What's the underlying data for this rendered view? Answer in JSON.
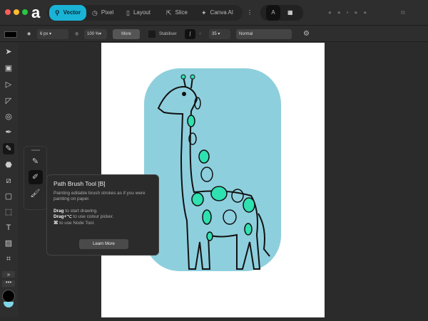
{
  "personas": [
    {
      "label": "Vector",
      "icon": "vector-icon"
    },
    {
      "label": "Pixel",
      "icon": "pixel-icon"
    },
    {
      "label": "Layout",
      "icon": "layout-icon"
    },
    {
      "label": "Slice",
      "icon": "slice-icon"
    },
    {
      "label": "Canva AI",
      "icon": "sparkle-icon"
    }
  ],
  "context": {
    "size": "6 px",
    "opacity": "100 %",
    "more": "More",
    "stabiliser": "Stabiliser",
    "stabiliser_value": "35",
    "blend_mode": "Normal"
  },
  "tooltip": {
    "title": "Path Brush Tool [B]",
    "description": "Painting editable brush strokes as if you were painting on paper.",
    "line1_key": "Drag",
    "line1": " to start drawing.",
    "line2_key": "Drag+⌥",
    "line2": " to use colour picker.",
    "line3_key": "⌘",
    "line3": " to use Node Tool.",
    "button": "Learn More"
  },
  "colors": {
    "accent": "#19b3d6",
    "shape": "#8ecfdd",
    "spots": "#2fe0b0"
  }
}
